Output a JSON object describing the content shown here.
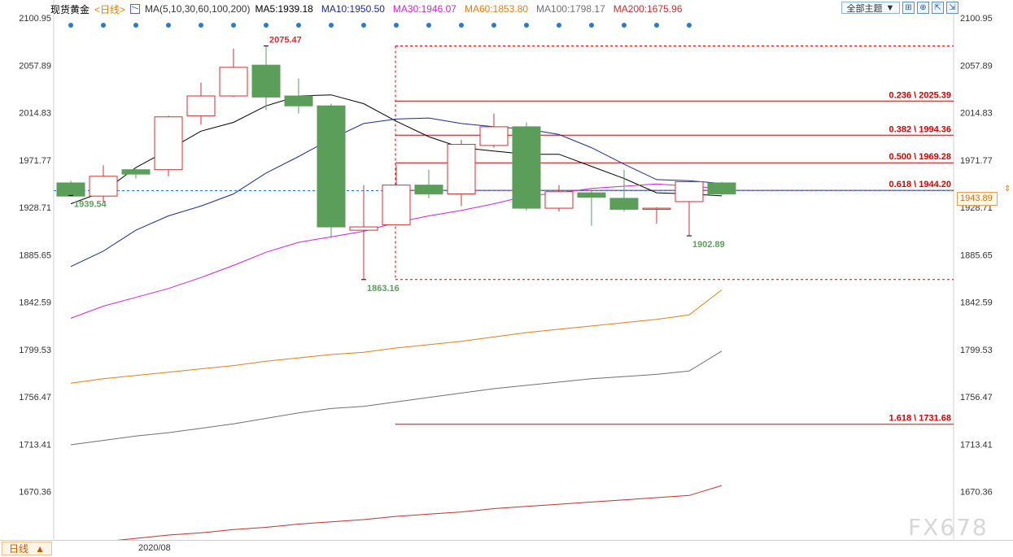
{
  "header": {
    "title": "现货黄金",
    "period": "<日线>",
    "ma_label": "MA(5,10,30,60,100,200)",
    "ma_values": [
      {
        "text": "MA5:1939.18",
        "color": "#000000"
      },
      {
        "text": "MA10:1950.50",
        "color": "#1c2a8c"
      },
      {
        "text": "MA30:1946.07",
        "color": "#d020d0"
      },
      {
        "text": "MA60:1853.80",
        "color": "#e08010"
      },
      {
        "text": "MA100:1798.17",
        "color": "#707070"
      },
      {
        "text": "MA200:1675.96",
        "color": "#c03030"
      }
    ]
  },
  "toolbar": {
    "theme_label": "全部主题",
    "theme_arrow": "▼",
    "buttons": [
      {
        "name": "grid-layout-icon",
        "glyph": "⊞"
      },
      {
        "name": "crosshair-icon",
        "glyph": "⊕"
      },
      {
        "name": "export-icon",
        "glyph": "⇱"
      },
      {
        "name": "expand-icon",
        "glyph": "⇲"
      }
    ]
  },
  "footer": {
    "period_tab": "日线",
    "period_arrow": "▲",
    "date_label": "2020/08"
  },
  "watermark": "FX678",
  "current_price": "1943.89",
  "current_price_arrow": "⇕",
  "colors": {
    "up": "#d03030",
    "down": "#5a9e5a",
    "fib": "#d00000",
    "price_dash": "#3070d0",
    "axis_text": "#333333",
    "label_green": "#5a9e5a",
    "label_red": "#d03030"
  },
  "chart_data": {
    "type": "candlestick",
    "y_axis_ticks": [
      "2100.95",
      "2057.89",
      "2014.83",
      "1971.77",
      "1928.71",
      "1885.65",
      "1842.59",
      "1799.53",
      "1756.47",
      "1713.41",
      "1670.36"
    ],
    "ylim": [
      1627.3,
      2100.95
    ],
    "candles": [
      {
        "o": 1951,
        "h": 1953,
        "l": 1939.54,
        "c": 1939
      },
      {
        "o": 1939,
        "h": 1967,
        "l": 1933,
        "c": 1957
      },
      {
        "o": 1963,
        "h": 1964,
        "l": 1955,
        "c": 1959
      },
      {
        "o": 1963,
        "h": 2012,
        "l": 1957,
        "c": 2011
      },
      {
        "o": 2012,
        "h": 2042,
        "l": 2004,
        "c": 2030
      },
      {
        "o": 2030,
        "h": 2073,
        "l": 2029,
        "c": 2056
      },
      {
        "o": 2058,
        "h": 2075.47,
        "l": 2017,
        "c": 2029
      },
      {
        "o": 2030,
        "h": 2046,
        "l": 2014,
        "c": 2021
      },
      {
        "o": 2021,
        "h": 2023,
        "l": 1901,
        "c": 1911
      },
      {
        "o": 1908,
        "h": 1949,
        "l": 1863.16,
        "c": 1911
      },
      {
        "o": 1913,
        "h": 1967,
        "l": 1913,
        "c": 1949
      },
      {
        "o": 1949,
        "h": 1963,
        "l": 1937,
        "c": 1941
      },
      {
        "o": 1941,
        "h": 1990,
        "l": 1930,
        "c": 1986
      },
      {
        "o": 1985,
        "h": 2014,
        "l": 1983,
        "c": 2002
      },
      {
        "o": 2002,
        "h": 2006,
        "l": 1926,
        "c": 1928
      },
      {
        "o": 1928,
        "h": 1949,
        "l": 1925,
        "c": 1943
      },
      {
        "o": 1942,
        "h": 1945,
        "l": 1912,
        "c": 1938
      },
      {
        "o": 1937,
        "h": 1963,
        "l": 1925,
        "c": 1927
      },
      {
        "o": 1927,
        "h": 1929,
        "l": 1914,
        "c": 1928
      },
      {
        "o": 1934,
        "h": 1953,
        "l": 1902.89,
        "c": 1952
      },
      {
        "o": 1951,
        "h": 1952,
        "l": 1940,
        "c": 1941
      }
    ],
    "ma_lines": [
      {
        "name": "MA5",
        "color": "#000000",
        "values": [
          1932,
          1943,
          1965,
          1981,
          1998,
          2006,
          2021,
          2030,
          2031,
          2023,
          2007,
          1993,
          1983,
          1980,
          1977,
          1977,
          1966,
          1955,
          1942,
          1941,
          1939.18
        ]
      },
      {
        "name": "MA10",
        "color": "#1c2a8c",
        "values": [
          1875,
          1889,
          1908,
          1921,
          1930,
          1941,
          1960,
          1975,
          1991,
          2005,
          2009,
          2010,
          2005,
          2002,
          2000,
          1995,
          1983,
          1968,
          1954,
          1953,
          1950.5
        ]
      },
      {
        "name": "MA30",
        "color": "#d020d0",
        "values": [
          1828,
          1839,
          1847,
          1855,
          1865,
          1876,
          1888,
          1897,
          1902,
          1907,
          1915,
          1921,
          1926,
          1932,
          1939,
          1942,
          1946,
          1948,
          1950,
          1948,
          1946.07
        ]
      },
      {
        "name": "MA60",
        "color": "#e08010",
        "values": [
          1769,
          1773,
          1776,
          1779,
          1782,
          1785,
          1789,
          1792,
          1795,
          1797,
          1801,
          1804,
          1807,
          1811,
          1815,
          1818,
          1821,
          1824,
          1827,
          1831,
          1853.8
        ]
      },
      {
        "name": "MA100",
        "color": "#707070",
        "values": [
          1713,
          1717,
          1721,
          1724,
          1728,
          1732,
          1737,
          1742,
          1746,
          1748,
          1752,
          1756,
          1760,
          1764,
          1767,
          1770,
          1773,
          1775,
          1777,
          1780,
          1798.17
        ]
      },
      {
        "name": "MA200",
        "color": "#c03030",
        "values": [
          1623,
          1625,
          1628,
          1631,
          1633,
          1636,
          1638,
          1641,
          1643,
          1645,
          1648,
          1650,
          1652,
          1655,
          1657,
          1659,
          1661,
          1663,
          1665,
          1667,
          1675.96
        ]
      }
    ],
    "fib_levels": [
      {
        "label": "0.236 \\ 2025.39",
        "value": 2025.39
      },
      {
        "label": "0.382 \\ 1994.36",
        "value": 1994.36
      },
      {
        "label": "0.500 \\ 1969.28",
        "value": 1969.28
      },
      {
        "label": "0.618 \\ 1944.20",
        "value": 1944.2
      },
      {
        "label": "1.618 \\ 1731.68",
        "value": 1731.68
      }
    ],
    "fib_box": {
      "top": 2075.47,
      "bottom": 1863.16
    },
    "annotations": [
      {
        "text": "2075.47",
        "color": "red",
        "candle": 6,
        "at": 2075.47,
        "pos": "above"
      },
      {
        "text": "1939.54",
        "color": "green",
        "candle": 0,
        "at": 1939.54,
        "pos": "below"
      },
      {
        "text": "1863.16",
        "color": "green",
        "candle": 9,
        "at": 1863.16,
        "pos": "below"
      },
      {
        "text": "1902.89",
        "color": "green",
        "candle": 19,
        "at": 1902.89,
        "pos": "below"
      }
    ],
    "current_price": 1943.89,
    "event_dots": 20
  }
}
